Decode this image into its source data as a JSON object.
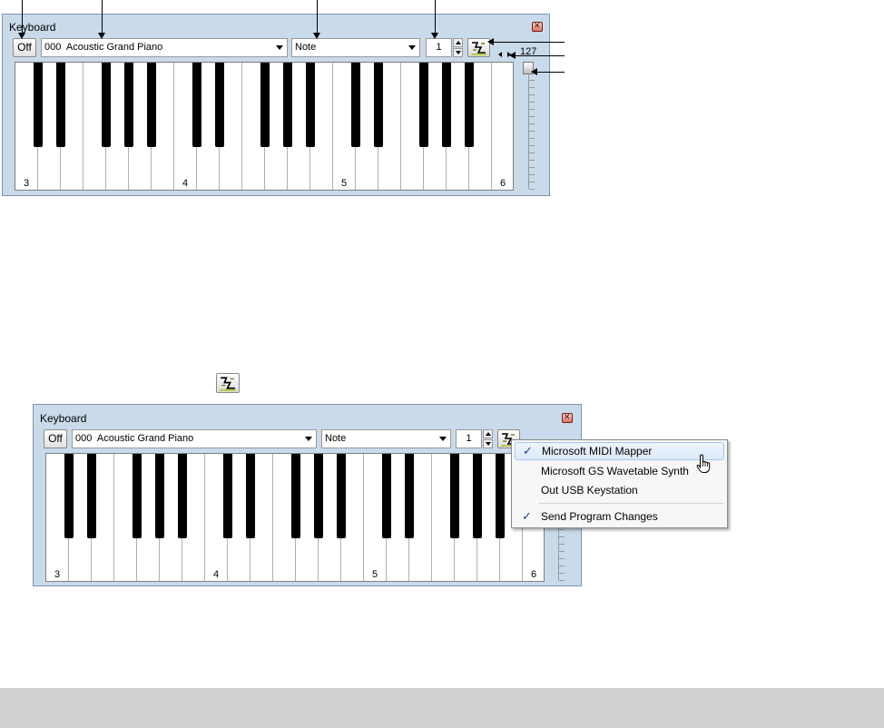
{
  "top_window": {
    "title": "Keyboard",
    "off_label": "Off",
    "patch_number": "000",
    "patch_name": "Acoustic Grand Piano",
    "mode": "Note",
    "channel": "1",
    "velocity_value": "127",
    "octave_labels": [
      "3",
      "4",
      "5",
      "6"
    ]
  },
  "bottom_window": {
    "title": "Keyboard",
    "off_label": "Off",
    "patch_number": "000",
    "patch_name": "Acoustic Grand Piano",
    "mode": "Note",
    "channel": "1",
    "octave_labels": [
      "3",
      "4",
      "5",
      "6"
    ]
  },
  "dropdown_menu": {
    "items": [
      {
        "label": "Microsoft MIDI Mapper",
        "checked": true,
        "highlighted": true
      },
      {
        "label": "Microsoft GS Wavetable Synth",
        "checked": false,
        "highlighted": false
      },
      {
        "label": "Out USB Keystation",
        "checked": false,
        "highlighted": false
      },
      {
        "label": "Send Program Changes",
        "checked": true,
        "highlighted": false
      }
    ]
  },
  "colors": {
    "window_bg": "#c9daea",
    "menu_highlight": "#dbe9f9",
    "footer_bar": "#d0d0d0"
  },
  "icons": [
    "midi-output-icon",
    "close-icon",
    "hand-cursor-icon",
    "check-icon"
  ]
}
